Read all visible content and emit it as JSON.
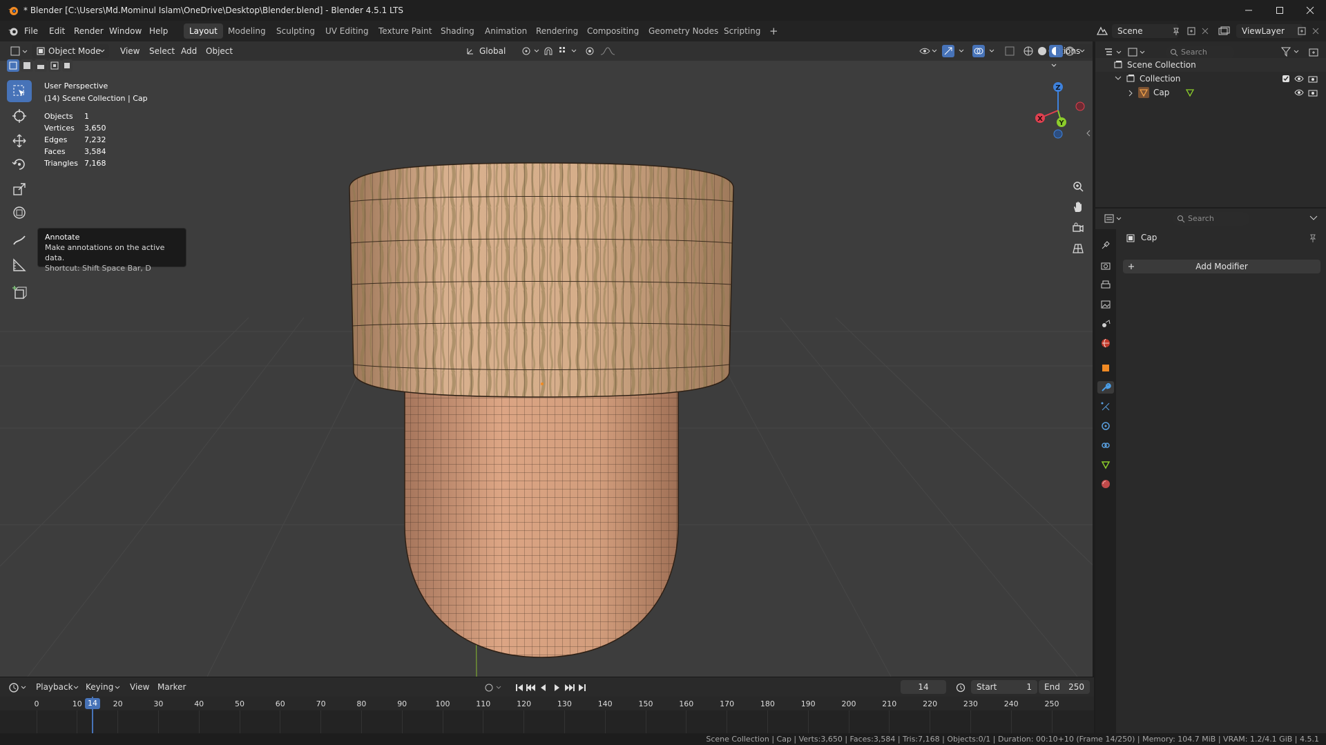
{
  "title_bar": {
    "title": "* Blender [C:\\Users\\Md.Mominul Islam\\OneDrive\\Desktop\\Blender.blend] - Blender 4.5.1 LTS",
    "controls": [
      "minimize",
      "maximize",
      "close"
    ]
  },
  "menu": {
    "items": [
      "File",
      "Edit",
      "Render",
      "Window",
      "Help"
    ]
  },
  "workspaces": {
    "tabs": [
      "Layout",
      "Modeling",
      "Sculpting",
      "UV Editing",
      "Texture Paint",
      "Shading",
      "Animation",
      "Rendering",
      "Compositing",
      "Geometry Nodes",
      "Scripting"
    ],
    "active": "Layout",
    "add_label": "+"
  },
  "scene": {
    "name": "Scene",
    "view_layer": "ViewLayer"
  },
  "viewport_header": {
    "mode": "Object Mode",
    "menus": [
      "View",
      "Select",
      "Add",
      "Object"
    ],
    "orientation": "Global",
    "options_label": "Options"
  },
  "overlay": {
    "perspective": "User Perspective",
    "context": "(14) Scene Collection | Cap",
    "stats": [
      {
        "label": "Objects",
        "value": "1"
      },
      {
        "label": "Vertices",
        "value": "3,650"
      },
      {
        "label": "Edges",
        "value": "7,232"
      },
      {
        "label": "Faces",
        "value": "3,584"
      },
      {
        "label": "Triangles",
        "value": "7,168"
      }
    ]
  },
  "tooltip": {
    "title": "Annotate",
    "description": "Make annotations on the active data.",
    "shortcut": "Shortcut: Shift Space Bar, D"
  },
  "gizmo": {
    "x": "X",
    "y": "Y",
    "z": "Z"
  },
  "outliner": {
    "search_placeholder": "Search",
    "root": "Scene Collection",
    "collection": "Collection",
    "object": "Cap"
  },
  "properties": {
    "search_placeholder": "Search",
    "object_name": "Cap",
    "add_modifier": "Add Modifier",
    "tabs": [
      "tool",
      "render",
      "output",
      "view-layer",
      "scene",
      "world",
      "object",
      "modifiers",
      "particles",
      "physics",
      "constraints",
      "data",
      "material"
    ],
    "active_tab": "modifiers"
  },
  "timeline": {
    "menus": [
      "Playback",
      "Keying",
      "View",
      "Marker"
    ],
    "current_frame": "14",
    "start_label": "Start",
    "start": "1",
    "end_label": "End",
    "end": "250",
    "ticks": [
      "0",
      "10",
      "20",
      "30",
      "40",
      "50",
      "60",
      "70",
      "80",
      "90",
      "100",
      "110",
      "120",
      "130",
      "140",
      "150",
      "160",
      "170",
      "180",
      "190",
      "200",
      "210",
      "220",
      "230",
      "240",
      "250"
    ],
    "playhead": "14"
  },
  "status_bar": {
    "text": "Scene Collection | Cap | Verts:3,650 | Faces:3,584 | Tris:7,168 | Objects:0/1 | Duration: 00:10+10 (Frame 14/250) | Memory: 104.7 MiB | VRAM: 1.2/4.1 GiB | 4.5.1"
  },
  "colors": {
    "accent": "#4773b8",
    "viewport_bg": "#3d3d3d",
    "panel_bg": "#2a2a2a",
    "wood_light": "#d4a27e",
    "wood_dark": "#a5784e",
    "axis_x": "#e0404f",
    "axis_y": "#8ccd2b",
    "axis_z": "#3e82dd"
  }
}
